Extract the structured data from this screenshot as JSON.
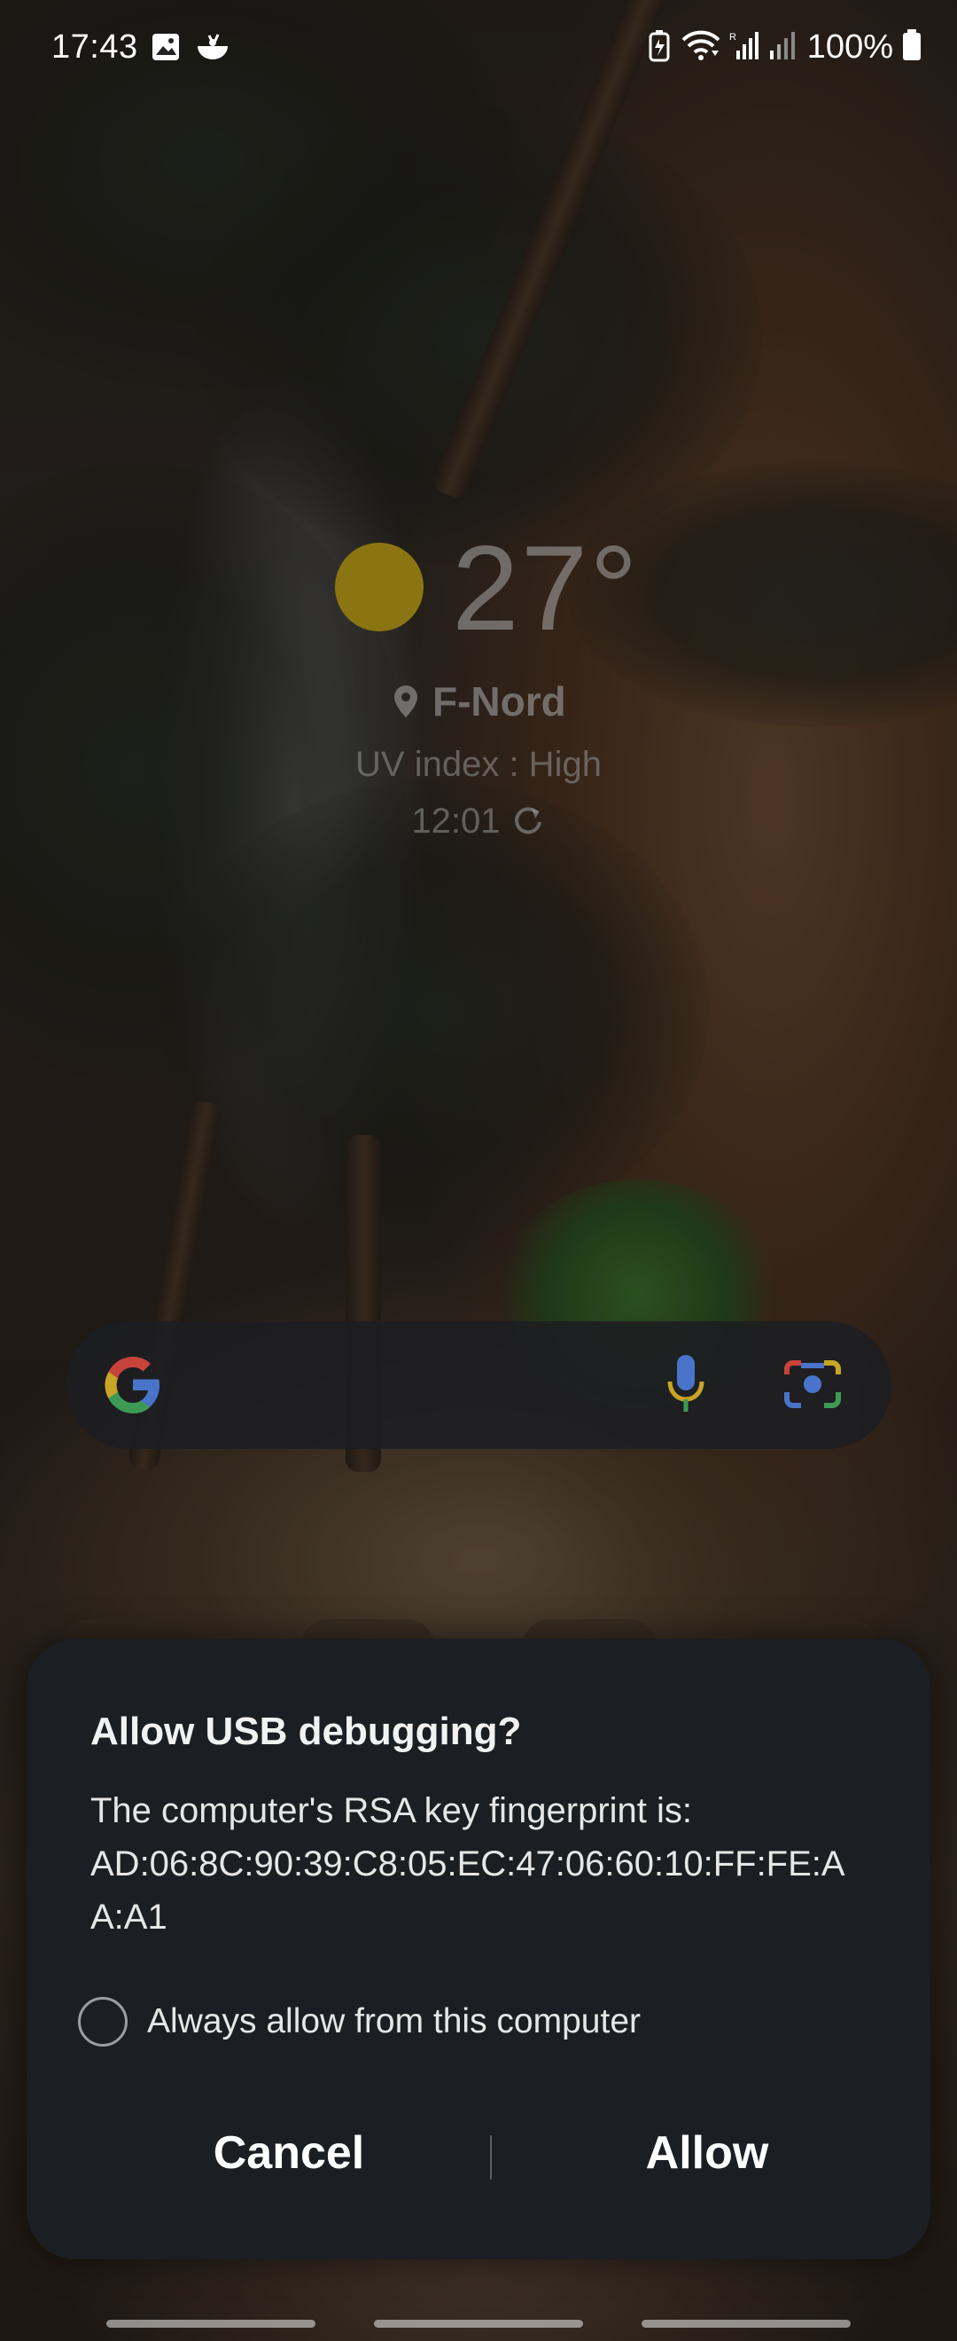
{
  "status_bar": {
    "time": "17:43",
    "battery": "100%",
    "left_icons": [
      "gallery-icon",
      "food-icon"
    ],
    "right_icons": [
      "battery-saver-icon",
      "wifi-icon",
      "signal-icon",
      "signal-weak-icon",
      "battery-icon"
    ]
  },
  "weather": {
    "temperature": "27°",
    "location": "F-Nord",
    "uv_index": "UV index : High",
    "updated_time": "12:01"
  },
  "search_bar": {
    "icons": [
      "google-logo-icon",
      "microphone-icon",
      "lens-camera-icon"
    ]
  },
  "dialog": {
    "title": "Allow USB debugging?",
    "body_line1": "The computer's RSA key fingerprint is:",
    "body_line2": "AD:06:8C:90:39:C8:05:EC:47:06:60:10:FF:FE:A",
    "body_line3": "A:A1",
    "checkbox_label": "Always allow from this computer",
    "checkbox_checked": false,
    "cancel_label": "Cancel",
    "allow_label": "Allow"
  },
  "colors": {
    "dialog_bg": "#1b1e23",
    "text_primary": "#f2f2f2",
    "sun": "#8a7512"
  }
}
